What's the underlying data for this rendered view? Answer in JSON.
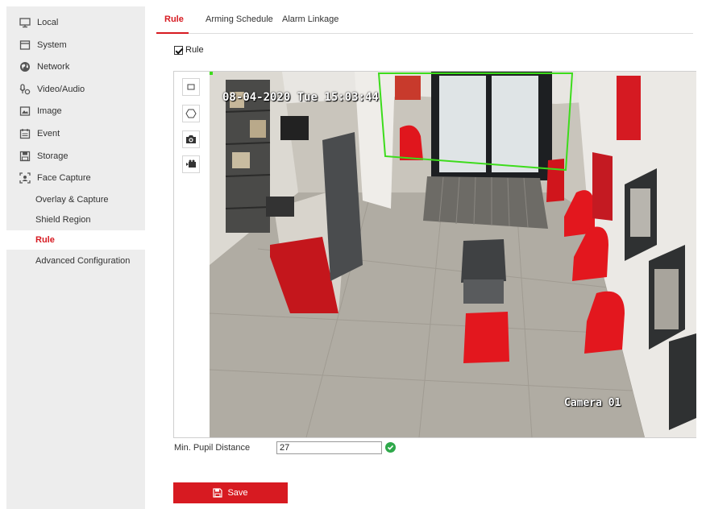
{
  "sidebar": {
    "items": [
      {
        "label": "Local",
        "icon": "monitor-icon"
      },
      {
        "label": "System",
        "icon": "system-window-icon"
      },
      {
        "label": "Network",
        "icon": "globe-icon"
      },
      {
        "label": "Video/Audio",
        "icon": "video-audio-icon"
      },
      {
        "label": "Image",
        "icon": "image-icon"
      },
      {
        "label": "Event",
        "icon": "calendar-icon"
      },
      {
        "label": "Storage",
        "icon": "storage-icon"
      },
      {
        "label": "Face Capture",
        "icon": "face-capture-icon"
      }
    ],
    "sub_items": [
      {
        "label": "Overlay & Capture"
      },
      {
        "label": "Shield Region"
      },
      {
        "label": "Rule",
        "active": true
      },
      {
        "label": "Advanced Configuration"
      }
    ]
  },
  "tabs": [
    {
      "label": "Rule",
      "active": true
    },
    {
      "label": "Arming Schedule"
    },
    {
      "label": "Alarm Linkage"
    }
  ],
  "rule_checkbox": {
    "label": "Rule",
    "checked": true
  },
  "toolbar": {
    "tools": [
      "rectangle-tool-icon",
      "polygon-tool-icon",
      "camera-snapshot-icon",
      "video-record-icon"
    ]
  },
  "video": {
    "osd_time": "08-04-2020 Tue 15:03:44",
    "osd_camera": "Camera 01",
    "detection_color": "#3ddc1c"
  },
  "form": {
    "pupil_label": "Min. Pupil Distance",
    "pupil_value": "27"
  },
  "save_label": "Save",
  "colors": {
    "accent": "#d71a21",
    "success": "#2ea84a"
  }
}
